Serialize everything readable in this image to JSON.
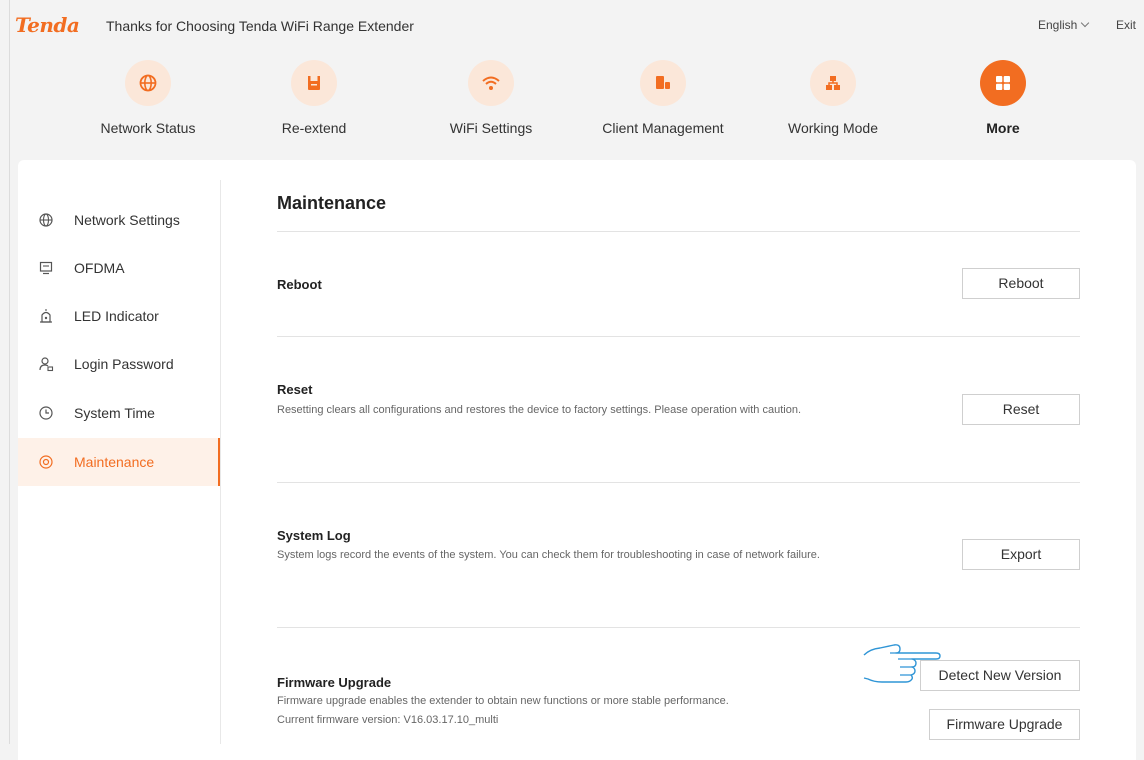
{
  "header": {
    "logo": "Tenda",
    "slogan": "Thanks for Choosing Tenda WiFi Range Extender",
    "language": "English",
    "exit": "Exit"
  },
  "nav": [
    {
      "label": "Network Status",
      "icon": "globe-icon"
    },
    {
      "label": "Re-extend",
      "icon": "extender-icon"
    },
    {
      "label": "WiFi Settings",
      "icon": "wifi-icon"
    },
    {
      "label": "Client Management",
      "icon": "client-icon"
    },
    {
      "label": "Working Mode",
      "icon": "mode-icon"
    },
    {
      "label": "More",
      "icon": "grid-icon",
      "active": true
    }
  ],
  "sidebar": [
    {
      "label": "Network Settings",
      "icon": "globe-icon"
    },
    {
      "label": "OFDMA",
      "icon": "monitor-icon"
    },
    {
      "label": "LED Indicator",
      "icon": "led-icon"
    },
    {
      "label": "Login Password",
      "icon": "user-lock-icon"
    },
    {
      "label": "System Time",
      "icon": "clock-icon"
    },
    {
      "label": "Maintenance",
      "icon": "target-icon",
      "active": true
    }
  ],
  "main": {
    "title": "Maintenance",
    "reboot": {
      "title": "Reboot",
      "button": "Reboot"
    },
    "reset": {
      "title": "Reset",
      "desc": "Resetting clears all configurations and restores the device to factory settings. Please operation with caution.",
      "button": "Reset"
    },
    "syslog": {
      "title": "System Log",
      "desc": "System logs record the events of the system. You can check them for troubleshooting in case of network failure.",
      "button": "Export"
    },
    "firmware": {
      "title": "Firmware Upgrade",
      "desc": "Firmware upgrade enables the extender to obtain new functions or more stable performance.",
      "version": "Current firmware version: V16.03.17.10_multi",
      "detect_button": "Detect New Version",
      "upgrade_button": "Firmware Upgrade"
    }
  },
  "colors": {
    "accent": "#f26d21",
    "accent_light": "#fbe7d9"
  }
}
